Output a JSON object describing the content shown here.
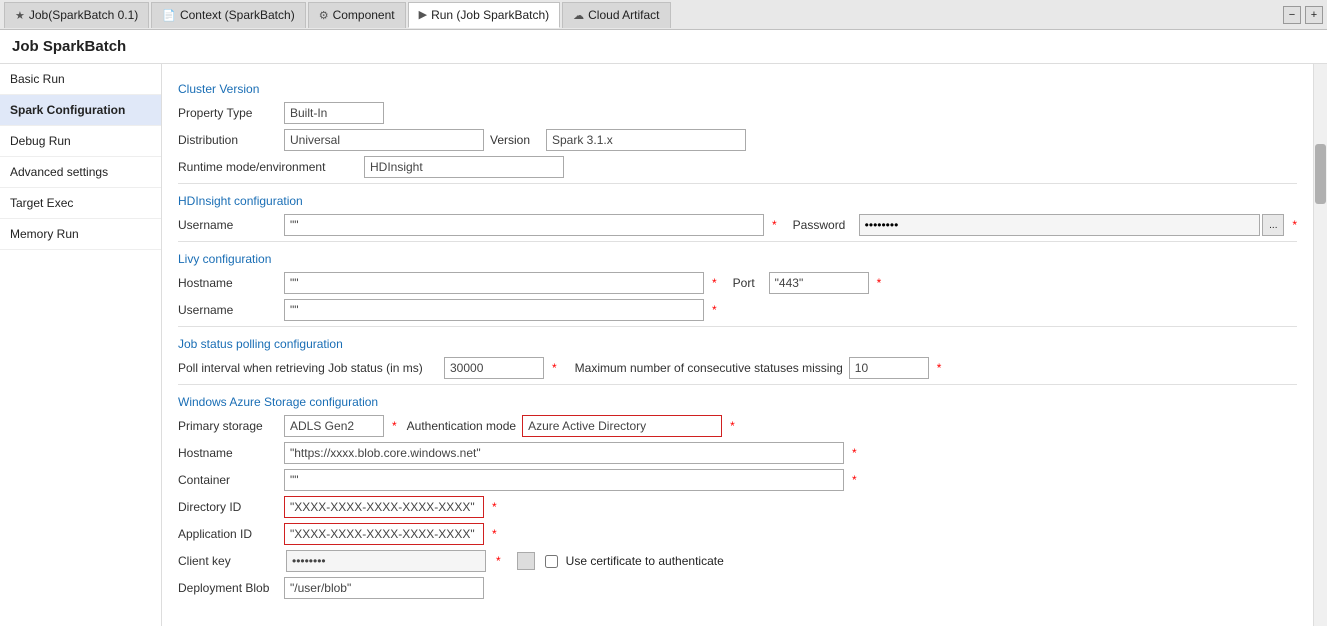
{
  "tabs": [
    {
      "id": "job",
      "label": "Job(SparkBatch 0.1)",
      "icon": "★",
      "active": false
    },
    {
      "id": "context",
      "label": "Context (SparkBatch)",
      "icon": "📄",
      "active": false
    },
    {
      "id": "component",
      "label": "Component",
      "icon": "⚙",
      "active": false
    },
    {
      "id": "run",
      "label": "Run (Job SparkBatch)",
      "icon": "▶",
      "active": true
    },
    {
      "id": "cloud",
      "label": "Cloud Artifact",
      "icon": "☁",
      "active": false
    }
  ],
  "tab_controls": {
    "minimize": "−",
    "maximize": "+"
  },
  "page_title": "Job SparkBatch",
  "sidebar": {
    "items": [
      {
        "id": "basic-run",
        "label": "Basic Run",
        "active": false
      },
      {
        "id": "spark-config",
        "label": "Spark Configuration",
        "active": true
      },
      {
        "id": "debug-run",
        "label": "Debug Run",
        "active": false
      },
      {
        "id": "advanced-settings",
        "label": "Advanced settings",
        "active": false
      },
      {
        "id": "target-exec",
        "label": "Target Exec",
        "active": false
      },
      {
        "id": "memory-run",
        "label": "Memory Run",
        "active": false
      }
    ]
  },
  "form": {
    "cluster_version_label": "Cluster Version",
    "property_type_label": "Property Type",
    "property_type_value": "Built-In",
    "distribution_label": "Distribution",
    "distribution_value": "Universal",
    "version_label": "Version",
    "version_value": "Spark 3.1.x",
    "runtime_mode_label": "Runtime mode/environment",
    "runtime_mode_value": "HDInsight",
    "hdinsight_section": "HDInsight configuration",
    "username_label": "Username",
    "username_value": "\"\"",
    "password_label": "Password",
    "password_value": "••••••••",
    "livy_section": "Livy configuration",
    "hostname_label": "Hostname",
    "hostname_value": "\"\"",
    "port_label": "Port",
    "port_value": "\"443\"",
    "username2_label": "Username",
    "username2_value": "\"\"",
    "job_status_section": "Job status polling configuration",
    "poll_interval_label": "Poll interval when retrieving Job status (in ms)",
    "poll_interval_value": "30000",
    "max_consecutive_label": "Maximum number of consecutive statuses missing",
    "max_consecutive_value": "10",
    "windows_azure_section": "Windows Azure Storage configuration",
    "primary_storage_label": "Primary storage",
    "primary_storage_value": "ADLS Gen2",
    "auth_mode_label": "Authentication mode",
    "auth_mode_value": "Azure Active Directory",
    "hostname2_label": "Hostname",
    "hostname2_value": "\"https://xxxx.blob.core.windows.net\"",
    "container_label": "Container",
    "container_value": "\"\"",
    "directory_id_label": "Directory ID",
    "directory_id_value": "\"XXXX-XXXX-XXXX-XXXX-XXXX\"",
    "application_id_label": "Application ID",
    "application_id_value": "\"XXXX-XXXX-XXXX-XXXX-XXXX\"",
    "client_key_label": "Client key",
    "client_key_value": "••••••••",
    "use_cert_label": "Use certificate to authenticate",
    "deployment_blob_label": "Deployment Blob",
    "deployment_blob_value": "\"/user/blob\""
  }
}
